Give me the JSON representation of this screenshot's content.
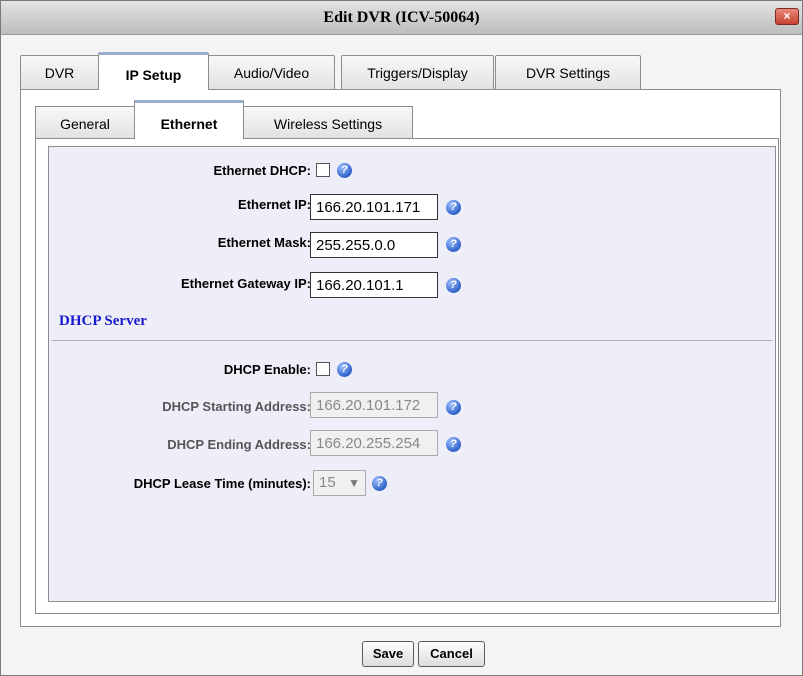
{
  "window": {
    "title": "Edit DVR (ICV-50064)",
    "close_icon": "×"
  },
  "tabs": [
    "DVR",
    "IP Setup",
    "Audio/Video",
    "Triggers/Display",
    "DVR Settings"
  ],
  "active_tab": "IP Setup",
  "subtabs": [
    "General",
    "Ethernet",
    "Wireless Settings"
  ],
  "active_subtab": "Ethernet",
  "ethernet": {
    "dhcp_label": "Ethernet DHCP:",
    "dhcp_checked": false,
    "ip_label": "Ethernet IP:",
    "ip_value": "166.20.101.171",
    "mask_label": "Ethernet Mask:",
    "mask_value": "255.255.0.0",
    "gateway_label": "Ethernet Gateway IP:",
    "gateway_value": "166.20.101.1"
  },
  "dhcp_server": {
    "section_title": "DHCP Server",
    "enable_label": "DHCP Enable:",
    "enable_checked": false,
    "start_label": "DHCP Starting Address:",
    "start_value": "166.20.101.172",
    "end_label": "DHCP Ending Address:",
    "end_value": "166.20.255.254",
    "lease_label": "DHCP Lease Time (minutes):",
    "lease_value": "15",
    "lease_arrow": "▼"
  },
  "help_icon": "?",
  "buttons": {
    "save": "Save",
    "cancel": "Cancel"
  },
  "colors": {
    "section_title": "#1a1acd",
    "content_bg": "#eeeef9",
    "help_icon": "#2f62c8"
  }
}
